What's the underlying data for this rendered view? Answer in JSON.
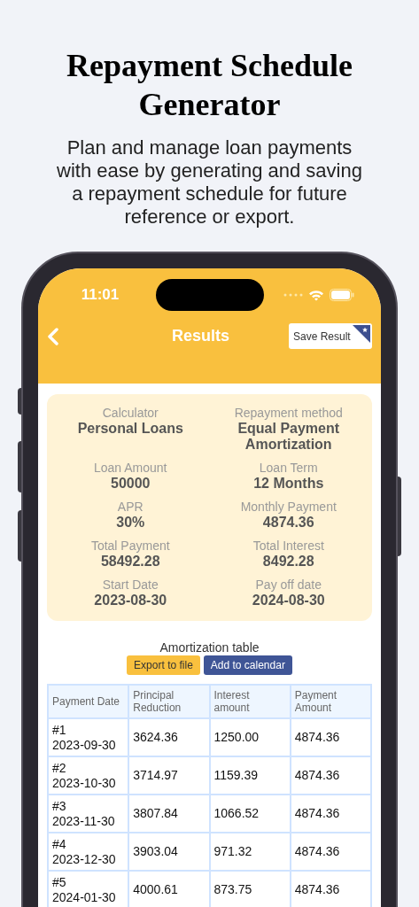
{
  "headline": "Repayment Schedule Generator",
  "subtitle": "Plan and manage loan payments with ease by generating and saving a repayment schedule for future reference or export.",
  "status_bar": {
    "time": "11:01"
  },
  "nav": {
    "title": "Results",
    "save_button": "Save Result"
  },
  "summary": [
    {
      "label": "Calculator",
      "value": "Personal Loans"
    },
    {
      "label": "Repayment method",
      "value": "Equal Payment Amortization"
    },
    {
      "label": "Loan Amount",
      "value": "50000"
    },
    {
      "label": "Loan Term",
      "value": "12 Months"
    },
    {
      "label": "APR",
      "value": "30%"
    },
    {
      "label": "Monthly Payment",
      "value": "4874.36"
    },
    {
      "label": "Total Payment",
      "value": "58492.28"
    },
    {
      "label": "Total Interest",
      "value": "8492.28"
    },
    {
      "label": "Start Date",
      "value": "2023-08-30"
    },
    {
      "label": "Pay off date",
      "value": "2024-08-30"
    }
  ],
  "table_title": "Amortization table",
  "actions": [
    {
      "label": "Export to file",
      "kind": "secondary"
    },
    {
      "label": "Add to calendar",
      "kind": "primary"
    }
  ],
  "table": {
    "columns": [
      "Payment Date",
      "Principal Reduction",
      "Interest amount",
      "Payment Amount"
    ],
    "rows": [
      [
        "#1\n2023-09-30",
        "3624.36",
        "1250.00",
        "4874.36"
      ],
      [
        "#2\n2023-10-30",
        "3714.97",
        "1159.39",
        "4874.36"
      ],
      [
        "#3\n2023-11-30",
        "3807.84",
        "1066.52",
        "4874.36"
      ],
      [
        "#4\n2023-12-30",
        "3903.04",
        "971.32",
        "4874.36"
      ],
      [
        "#5\n2024-01-30",
        "4000.61",
        "873.75",
        "4874.36"
      ]
    ]
  }
}
